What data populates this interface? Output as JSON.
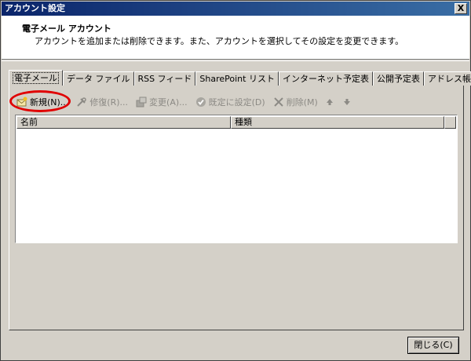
{
  "window": {
    "title": "アカウント設定",
    "close_glyph": "X"
  },
  "header": {
    "title": "電子メール アカウント",
    "description": "アカウントを追加または削除できます。また、アカウントを選択してその設定を変更できます。"
  },
  "tabs": [
    {
      "label": "電子メール",
      "active": true
    },
    {
      "label": "データ ファイル",
      "active": false
    },
    {
      "label": "RSS フィード",
      "active": false
    },
    {
      "label": "SharePoint リスト",
      "active": false
    },
    {
      "label": "インターネット予定表",
      "active": false
    },
    {
      "label": "公開予定表",
      "active": false
    },
    {
      "label": "アドレス帳",
      "active": false
    }
  ],
  "toolbar": {
    "new_label": "新規(N)...",
    "repair_label": "修復(R)...",
    "change_label": "変更(A)...",
    "default_label": "既定に設定(D)",
    "delete_label": "削除(M)"
  },
  "list": {
    "columns": [
      "名前",
      "種類"
    ],
    "rows": []
  },
  "footer": {
    "close_label": "閉じる(C)"
  },
  "colors": {
    "highlight": "#e00000",
    "dialog_bg": "#d4d0c8",
    "titlebar_start": "#0a246a"
  }
}
